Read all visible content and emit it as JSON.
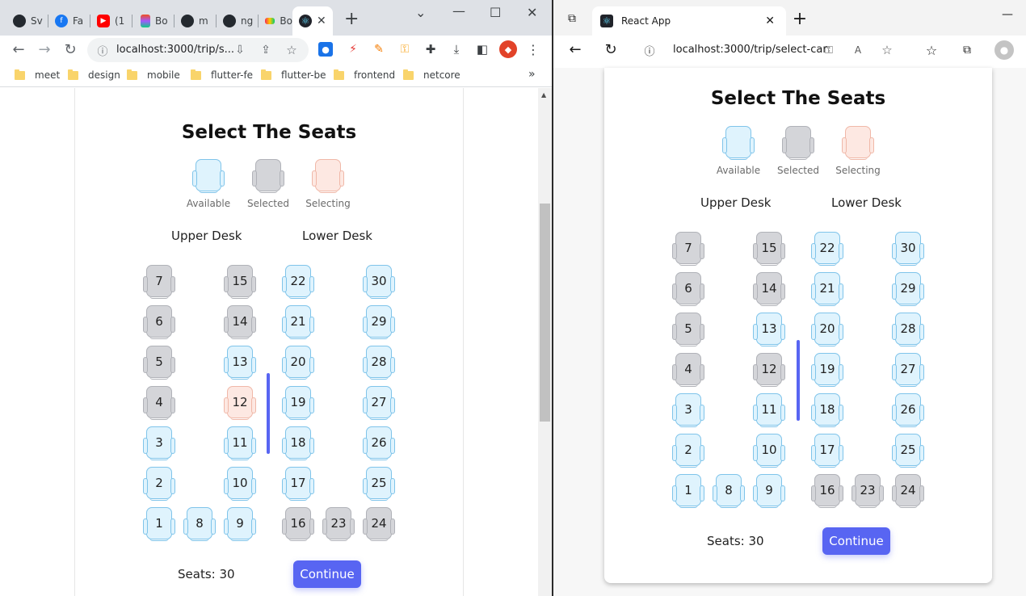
{
  "chrome": {
    "tabs": [
      {
        "label": "Sv",
        "icon": "github-icon"
      },
      {
        "label": "Fa",
        "icon": "facebook-icon"
      },
      {
        "label": "(1",
        "icon": "youtube-icon"
      },
      {
        "label": "Bo",
        "icon": "figma-icon"
      },
      {
        "label": "m",
        "icon": "github-icon"
      },
      {
        "label": "ng",
        "icon": "github-icon"
      },
      {
        "label": "Bo",
        "icon": "monday-icon"
      }
    ],
    "active_tab_close": "✕",
    "new_tab": "+",
    "url": "localhost:3000/trip/s...",
    "bookmarks": [
      "meet",
      "design",
      "mobile",
      "flutter-fe",
      "flutter-be",
      "frontend",
      "netcore"
    ],
    "bookmarks_more": "»"
  },
  "edge": {
    "tab_title": "React App",
    "url": "localhost:3000/trip/select-car"
  },
  "page": {
    "title": "Select The Seats",
    "legend": [
      {
        "label": "Available",
        "state": "available"
      },
      {
        "label": "Selected",
        "state": "selected"
      },
      {
        "label": "Selecting",
        "state": "selecting"
      }
    ],
    "upper_desk_label": "Upper Desk",
    "lower_desk_label": "Lower Desk",
    "seats_count_label": "Seats: 30",
    "continue_label": "Continue",
    "colors": {
      "available_fill": "#dff3fd",
      "selected_fill": "#d4d5d9",
      "selecting_fill": "#fde8e2",
      "accent": "#5865f2"
    }
  },
  "left_seats": [
    {
      "num": "7",
      "state": "selected"
    },
    {
      "num": "15",
      "state": "selected"
    },
    {
      "num": "22",
      "state": "available"
    },
    {
      "num": "30",
      "state": "available"
    },
    {
      "num": "6",
      "state": "selected"
    },
    {
      "num": "14",
      "state": "selected"
    },
    {
      "num": "21",
      "state": "available"
    },
    {
      "num": "29",
      "state": "available"
    },
    {
      "num": "5",
      "state": "selected"
    },
    {
      "num": "13",
      "state": "available"
    },
    {
      "num": "20",
      "state": "available"
    },
    {
      "num": "28",
      "state": "available"
    },
    {
      "num": "4",
      "state": "selected"
    },
    {
      "num": "12",
      "state": "selecting"
    },
    {
      "num": "19",
      "state": "available"
    },
    {
      "num": "27",
      "state": "available"
    },
    {
      "num": "3",
      "state": "available"
    },
    {
      "num": "11",
      "state": "available"
    },
    {
      "num": "18",
      "state": "available"
    },
    {
      "num": "26",
      "state": "available"
    },
    {
      "num": "2",
      "state": "available"
    },
    {
      "num": "10",
      "state": "available"
    },
    {
      "num": "17",
      "state": "available"
    },
    {
      "num": "25",
      "state": "available"
    },
    {
      "num": "1",
      "state": "available"
    },
    {
      "num": "8",
      "state": "available"
    },
    {
      "num": "9",
      "state": "available"
    },
    {
      "num": "16",
      "state": "selected"
    },
    {
      "num": "23",
      "state": "selected"
    },
    {
      "num": "24",
      "state": "selected"
    }
  ],
  "right_seats": [
    {
      "num": "7",
      "state": "selected"
    },
    {
      "num": "15",
      "state": "selected"
    },
    {
      "num": "22",
      "state": "available"
    },
    {
      "num": "30",
      "state": "available"
    },
    {
      "num": "6",
      "state": "selected"
    },
    {
      "num": "14",
      "state": "selected"
    },
    {
      "num": "21",
      "state": "available"
    },
    {
      "num": "29",
      "state": "available"
    },
    {
      "num": "5",
      "state": "selected"
    },
    {
      "num": "13",
      "state": "available"
    },
    {
      "num": "20",
      "state": "available"
    },
    {
      "num": "28",
      "state": "available"
    },
    {
      "num": "4",
      "state": "selected"
    },
    {
      "num": "12",
      "state": "selected"
    },
    {
      "num": "19",
      "state": "available"
    },
    {
      "num": "27",
      "state": "available"
    },
    {
      "num": "3",
      "state": "available"
    },
    {
      "num": "11",
      "state": "available"
    },
    {
      "num": "18",
      "state": "available"
    },
    {
      "num": "26",
      "state": "available"
    },
    {
      "num": "2",
      "state": "available"
    },
    {
      "num": "10",
      "state": "available"
    },
    {
      "num": "17",
      "state": "available"
    },
    {
      "num": "25",
      "state": "available"
    },
    {
      "num": "1",
      "state": "available"
    },
    {
      "num": "8",
      "state": "available"
    },
    {
      "num": "9",
      "state": "available"
    },
    {
      "num": "16",
      "state": "selected"
    },
    {
      "num": "23",
      "state": "selected"
    },
    {
      "num": "24",
      "state": "selected"
    }
  ]
}
